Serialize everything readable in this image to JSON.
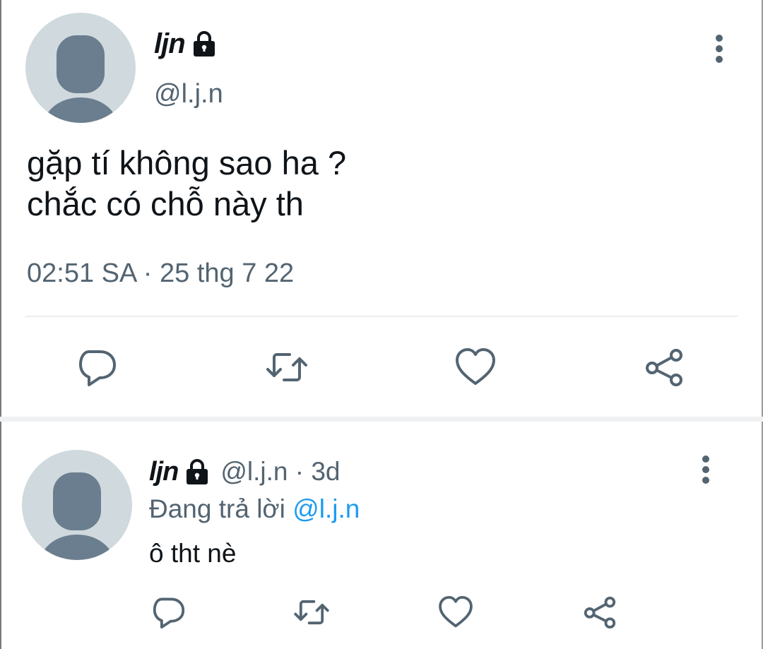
{
  "main_tweet": {
    "display_name": "ljn",
    "handle": "@l.j.n",
    "text_lines": [
      "gặp tí không sao ha ?",
      "chắc có chỗ này th"
    ],
    "timestamp": "02:51 SA · 25 thg 7 22"
  },
  "reply": {
    "display_name": "ljn",
    "meta": "@l.j.n · 3d",
    "replying_prefix": "Đang trả lời",
    "replying_to": "@l.j.n",
    "text": "ô tht nè"
  },
  "icons": {
    "reply": "reply-icon",
    "retweet": "retweet-icon",
    "like": "heart-icon",
    "share": "share-icon",
    "lock": "lock-icon",
    "more": "more-vertical-icon"
  },
  "colors": {
    "text_primary": "#0f1419",
    "text_secondary": "#536471",
    "accent": "#1d9bf0",
    "avatar_bg": "#cfd9de",
    "avatar_fg": "#6b7e8f"
  }
}
